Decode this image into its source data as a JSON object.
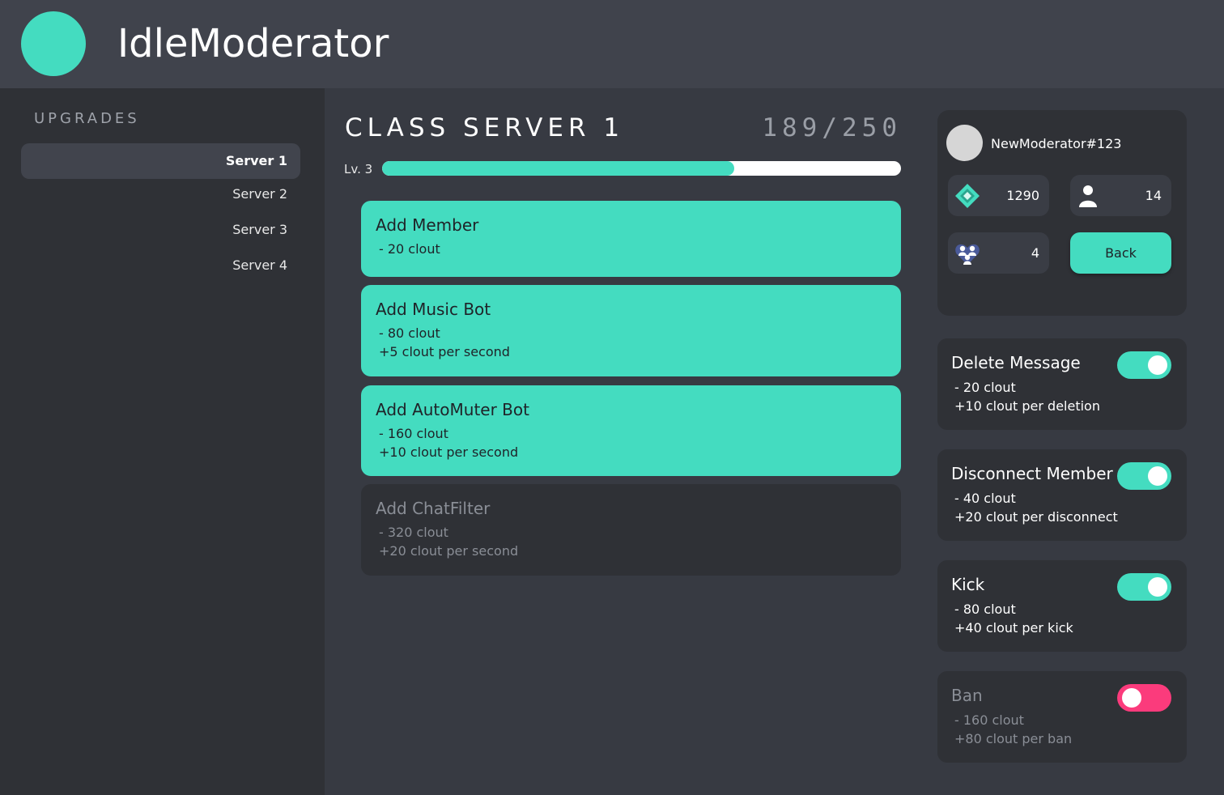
{
  "app": {
    "title": "IdleModerator"
  },
  "sidebar": {
    "heading": "UPGRADES",
    "items": [
      {
        "label": "Server 1",
        "active": true
      },
      {
        "label": "Server 2",
        "active": false
      },
      {
        "label": "Server 3",
        "active": false
      },
      {
        "label": "Server 4",
        "active": false
      }
    ]
  },
  "server": {
    "title": "CLASS SERVER 1",
    "count": "189/250",
    "level_label": "Lv. 3",
    "progress": 0.678
  },
  "upgrades": [
    {
      "title": "Add Member",
      "lines": [
        "- 20 clout"
      ],
      "available": true
    },
    {
      "title": "Add Music Bot",
      "lines": [
        "- 80 clout",
        "+5 clout per second"
      ],
      "available": true
    },
    {
      "title": "Add AutoMuter Bot",
      "lines": [
        "- 160 clout",
        "+10 clout per second"
      ],
      "available": true
    },
    {
      "title": "Add ChatFilter",
      "lines": [
        "- 320 clout",
        "+20 clout per second"
      ],
      "available": false
    }
  ],
  "profile": {
    "username": "NewModerator#123",
    "clout": "1290",
    "members": "14",
    "groups": "4",
    "back_label": "Back"
  },
  "actions": [
    {
      "title": "Delete Message",
      "lines": [
        "- 20 clout",
        "+10 clout per deletion"
      ],
      "enabled": true
    },
    {
      "title": "Disconnect Member",
      "lines": [
        "- 40 clout",
        "+20 clout per disconnect"
      ],
      "enabled": true
    },
    {
      "title": "Kick",
      "lines": [
        "- 80 clout",
        "+40 clout per kick"
      ],
      "enabled": true
    },
    {
      "title": "Ban",
      "lines": [
        "- 160 clout",
        "+80 clout per ban"
      ],
      "enabled": false
    }
  ],
  "icons": {
    "clout": "diamond-icon",
    "members": "person-icon",
    "groups": "group-heart-icon"
  },
  "colors": {
    "accent": "#44dcc0",
    "danger": "#fb3b7c",
    "background": "#373a42",
    "panel": "#2f3136",
    "header": "#40434c"
  }
}
